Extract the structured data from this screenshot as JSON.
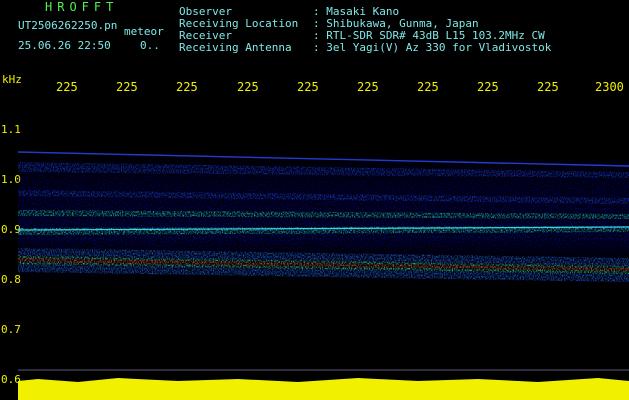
{
  "header": {
    "app_name": "HROFFT",
    "file_name": "UT2506262250.pn",
    "mode": "meteor",
    "datetime": "25.06.26 22:50",
    "flag": "0.."
  },
  "station_info": {
    "labels": "Observer\nReceiving Location\nReceiver\nReceiving Antenna",
    "values": ": Masaki Kano\n: Shibukawa, Gunma, Japan\n: RTL-SDR SDR# 43dB L15 103.2MHz CW\n: 3el Yagi(V) Az 330 for Vladivostok"
  },
  "axes": {
    "frequency_unit": "kHz",
    "time_ticks": [
      "225",
      "225",
      "225",
      "225",
      "225",
      "225",
      "225",
      "225",
      "225",
      "2300"
    ],
    "frequency_ticks": [
      "1.1",
      "1.0",
      "0.9",
      "0.8",
      "0.7",
      "0.6"
    ]
  },
  "colors": {
    "background": "#000000",
    "header_text": "#7fe8e8",
    "app_name": "#4ff04f",
    "axis_text": "#f0f000",
    "noise_band": "#f0f000",
    "signal_low": "#1a1aff",
    "signal_mid": "#22ccee",
    "signal_high": "#ff3030"
  }
}
